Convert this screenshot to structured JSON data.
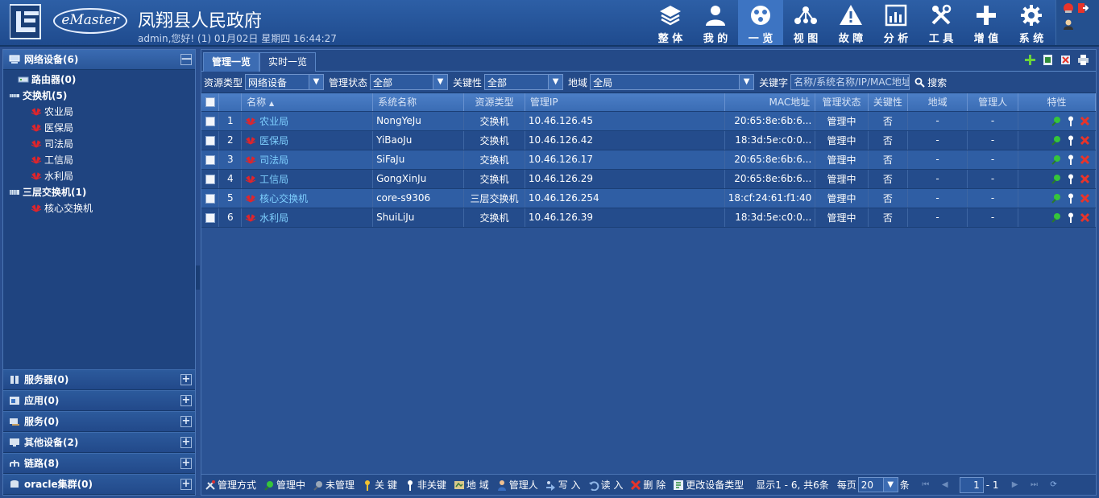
{
  "header": {
    "app_title": "凤翔县人民政府",
    "logo_text": "eMaster",
    "welcome": "admin,您好! (1) 01月02日 星期四 16:44:27",
    "nav": [
      {
        "label": "整 体",
        "icon": "layers-icon",
        "active": false
      },
      {
        "label": "我 的",
        "icon": "user-icon",
        "active": false
      },
      {
        "label": "一 览",
        "icon": "overview-icon",
        "active": true
      },
      {
        "label": "视 图",
        "icon": "topology-icon",
        "active": false
      },
      {
        "label": "故 障",
        "icon": "warning-icon",
        "active": false
      },
      {
        "label": "分 析",
        "icon": "chart-icon",
        "active": false
      },
      {
        "label": "工 具",
        "icon": "tools-icon",
        "active": false
      },
      {
        "label": "增 值",
        "icon": "plus-icon",
        "active": false
      },
      {
        "label": "系 统",
        "icon": "gear-icon",
        "active": false
      }
    ]
  },
  "sidebar": {
    "top_group": {
      "label": "网络设备(6)",
      "icon": "network-device-icon",
      "toggle": "—"
    },
    "tree": [
      {
        "label": "路由器(0)",
        "level": "l1",
        "icon": "router-icon"
      },
      {
        "label": "交换机(5)",
        "level": "l1b",
        "icon": "switch-icon"
      },
      {
        "label": "农业局",
        "level": "l2",
        "icon": "huawei-icon"
      },
      {
        "label": "医保局",
        "level": "l2",
        "icon": "huawei-icon"
      },
      {
        "label": "司法局",
        "level": "l2",
        "icon": "huawei-icon"
      },
      {
        "label": "工信局",
        "level": "l2",
        "icon": "huawei-icon"
      },
      {
        "label": "水利局",
        "level": "l2",
        "icon": "huawei-icon"
      },
      {
        "label": "三层交换机(1)",
        "level": "l1b",
        "icon": "l3switch-icon"
      },
      {
        "label": "核心交换机",
        "level": "l2",
        "icon": "huawei-icon"
      }
    ],
    "bottom_groups": [
      {
        "label": "服务器(0)",
        "icon": "server-icon"
      },
      {
        "label": "应用(0)",
        "icon": "app-icon"
      },
      {
        "label": "服务(0)",
        "icon": "service-icon"
      },
      {
        "label": "其他设备(2)",
        "icon": "monitor-icon"
      },
      {
        "label": "链路(8)",
        "icon": "link-icon"
      },
      {
        "label": "oracle集群(0)",
        "icon": "database-icon"
      }
    ],
    "expand_symbol": "+"
  },
  "tabs": [
    {
      "label": "管理一览",
      "active": true
    },
    {
      "label": "实时一览",
      "active": false
    }
  ],
  "filters": {
    "resource_type_label": "资源类型",
    "resource_type_value": "网络设备",
    "manage_state_label": "管理状态",
    "manage_state_value": "全部",
    "critical_label": "关键性",
    "critical_value": "全部",
    "region_label": "地域",
    "region_value": "全局",
    "keyword_label": "关键字",
    "keyword_placeholder": "名称/系统名称/IP/MAC地址",
    "search_label": "搜索"
  },
  "table": {
    "headers": {
      "name": "名称",
      "sysname": "系统名称",
      "restype": "资源类型",
      "ip": "管理IP",
      "mac": "MAC地址",
      "state": "管理状态",
      "critical": "关键性",
      "region": "地域",
      "manager": "管理人",
      "features": "特性"
    },
    "rows": [
      {
        "idx": "1",
        "name": "农业局",
        "sysname": "NongYeJu",
        "restype": "交换机",
        "ip": "10.46.126.45",
        "mac": "20:65:8e:6b:6...",
        "state": "管理中",
        "critical": "否",
        "region": "-",
        "manager": "-"
      },
      {
        "idx": "2",
        "name": "医保局",
        "sysname": "YiBaoJu",
        "restype": "交换机",
        "ip": "10.46.126.42",
        "mac": "18:3d:5e:c0:0...",
        "state": "管理中",
        "critical": "否",
        "region": "-",
        "manager": "-"
      },
      {
        "idx": "3",
        "name": "司法局",
        "sysname": "SiFaJu",
        "restype": "交换机",
        "ip": "10.46.126.17",
        "mac": "20:65:8e:6b:6...",
        "state": "管理中",
        "critical": "否",
        "region": "-",
        "manager": "-"
      },
      {
        "idx": "4",
        "name": "工信局",
        "sysname": "GongXinJu",
        "restype": "交换机",
        "ip": "10.46.126.29",
        "mac": "20:65:8e:6b:6...",
        "state": "管理中",
        "critical": "否",
        "region": "-",
        "manager": "-"
      },
      {
        "idx": "5",
        "name": "核心交换机",
        "sysname": "core-s9306",
        "restype": "三层交换机",
        "ip": "10.46.126.254",
        "mac": "18:cf:24:61:f1:40",
        "state": "管理中",
        "critical": "否",
        "region": "-",
        "manager": "-"
      },
      {
        "idx": "6",
        "name": "水利局",
        "sysname": "ShuiLiJu",
        "restype": "交换机",
        "ip": "10.46.126.39",
        "mac": "18:3d:5e:c0:0...",
        "state": "管理中",
        "critical": "否",
        "region": "-",
        "manager": "-"
      }
    ]
  },
  "bottom_bar": {
    "actions": [
      {
        "label": "管理方式",
        "icon": "tools-small-icon"
      },
      {
        "label": "管理中",
        "icon": "managed-icon"
      },
      {
        "label": "未管理",
        "icon": "unmanaged-icon"
      },
      {
        "label": "关 键",
        "icon": "key-icon"
      },
      {
        "label": "非关键",
        "icon": "key-white-icon"
      },
      {
        "label": "地 域",
        "icon": "region-icon"
      },
      {
        "label": "管理人",
        "icon": "person-icon"
      },
      {
        "label": "写 入",
        "icon": "write-icon"
      },
      {
        "label": "读 入",
        "icon": "read-icon"
      },
      {
        "label": "删 除",
        "icon": "delete-icon"
      },
      {
        "label": "更改设备类型",
        "icon": "change-type-icon"
      }
    ],
    "display_info": "显示1 - 6, 共6条",
    "per_page_label": "每页",
    "per_page_value": "20",
    "per_page_unit": "条",
    "page_value": "1",
    "page_total": "- 1"
  },
  "colors": {
    "header_bg": "#2d5fa6",
    "active_nav": "#3d74c2",
    "link": "#7fd0ff",
    "delete_red": "#e8342a",
    "managed_green": "#36c53a"
  }
}
